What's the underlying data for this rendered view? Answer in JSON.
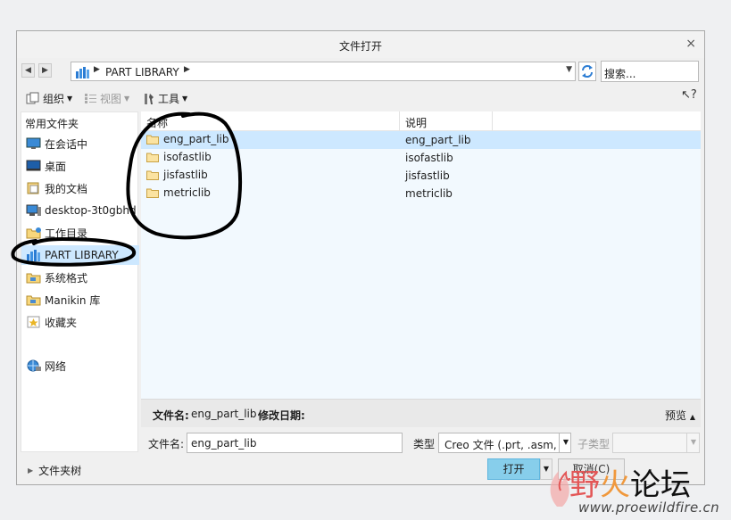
{
  "window": {
    "title": "文件打开",
    "close_glyph": "×"
  },
  "address": {
    "path": "PART LIBRARY",
    "search_placeholder": "搜索..."
  },
  "toolbar": {
    "organize": "组织",
    "view": "视图",
    "tools": "工具",
    "help_glyph": "?"
  },
  "sidebar": {
    "header": "常用文件夹",
    "items": [
      {
        "label": "在会话中",
        "icon": "monitor-icon"
      },
      {
        "label": "桌面",
        "icon": "desktop-icon"
      },
      {
        "label": "我的文档",
        "icon": "documents-icon"
      },
      {
        "label": "desktop-3t0gbhd",
        "icon": "computer-icon"
      },
      {
        "label": "工作目录",
        "icon": "working-dir-icon"
      },
      {
        "label": "PART LIBRARY",
        "icon": "library-icon",
        "selected": true
      },
      {
        "label": "系统格式",
        "icon": "system-format-icon"
      },
      {
        "label": "Manikin 库",
        "icon": "manikin-icon"
      },
      {
        "label": "收藏夹",
        "icon": "favorites-icon"
      },
      {
        "label": "网络",
        "icon": "network-icon"
      }
    ]
  },
  "filelist": {
    "columns": [
      "名称",
      "说明"
    ],
    "rows": [
      {
        "name": "eng_part_lib",
        "desc": "eng_part_lib"
      },
      {
        "name": "isofastlib",
        "desc": "isofastlib"
      },
      {
        "name": "jisfastlib",
        "desc": "jisfastlib"
      },
      {
        "name": "metriclib",
        "desc": "metriclib"
      }
    ]
  },
  "info": {
    "filename_label": "文件名:",
    "filename_value": "eng_part_lib",
    "date_label": "修改日期:",
    "preview": "预览"
  },
  "form": {
    "filename_label": "文件名:",
    "filename_value": "eng_part_lib",
    "type_label": "类型",
    "type_value": "Creo 文件 (.prt, .asm,",
    "subtype_label": "子类型"
  },
  "footer": {
    "tree": "文件夹树",
    "open": "打开",
    "cancel": "取消(C)"
  },
  "watermark": {
    "char1": "野",
    "char2": "火",
    "char3": "论坛",
    "url": "www.proewildfire.cn"
  },
  "colors": {
    "selected": "#cde8ff",
    "accent": "#87ceeb",
    "list_bg": "#f2f9fe"
  }
}
